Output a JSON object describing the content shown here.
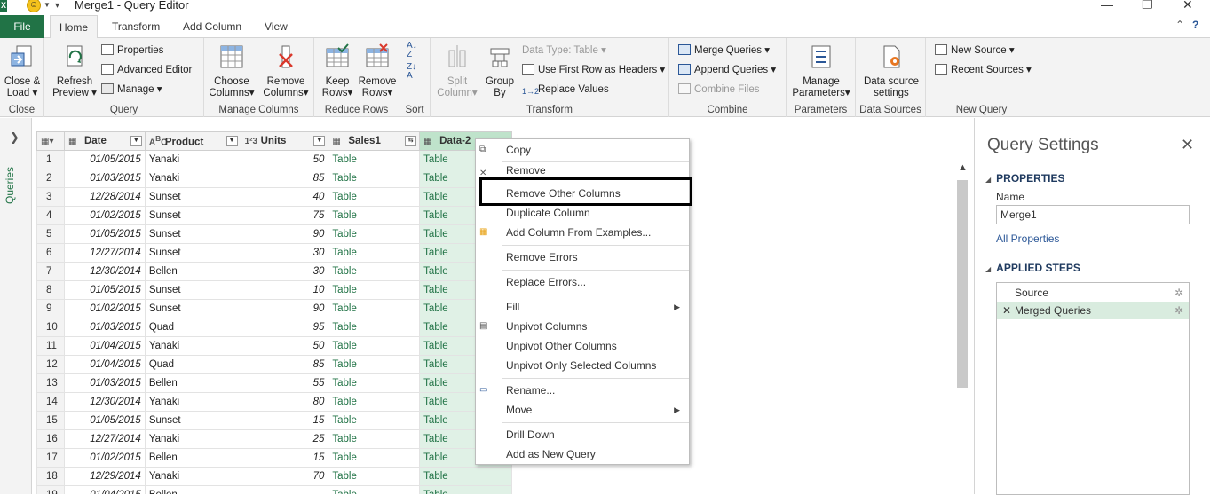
{
  "window": {
    "title": "Merge1 - Query Editor",
    "logo": "X"
  },
  "tabs": [
    "File",
    "Home",
    "Transform",
    "Add Column",
    "View"
  ],
  "ribbon": {
    "close": {
      "btn1": "Close &",
      "btn2": "Load",
      "label": "Close"
    },
    "query": {
      "refresh1": "Refresh",
      "refresh2": "Preview",
      "properties": "Properties",
      "advanced": "Advanced Editor",
      "manage": "Manage",
      "label": "Query"
    },
    "manage_columns": {
      "choose1": "Choose",
      "choose2": "Columns",
      "remove1": "Remove",
      "remove2": "Columns",
      "label": "Manage Columns"
    },
    "reduce_rows": {
      "keep1": "Keep",
      "keep2": "Rows",
      "remove1": "Remove",
      "remove2": "Rows",
      "label": "Reduce Rows"
    },
    "sort": {
      "label": "Sort"
    },
    "transform": {
      "split1": "Split",
      "split2": "Column",
      "group1": "Group",
      "group2": "By",
      "datatype": "Data Type: Table",
      "first_row": "Use First Row as Headers",
      "replace": "Replace Values",
      "label": "Transform"
    },
    "combine": {
      "merge": "Merge Queries",
      "append": "Append Queries",
      "files": "Combine Files",
      "label": "Combine"
    },
    "parameters": {
      "manage1": "Manage",
      "manage2": "Parameters",
      "label": "Parameters"
    },
    "data_sources": {
      "settings1": "Data source",
      "settings2": "settings",
      "label": "Data Sources"
    },
    "new_query": {
      "new_source": "New Source",
      "recent": "Recent Sources",
      "label": "New Query"
    }
  },
  "queries_pane": {
    "label": "Queries"
  },
  "table": {
    "columns": [
      {
        "name": "Date",
        "type_icon": "calendar"
      },
      {
        "name": "Product",
        "type_icon": "ABC"
      },
      {
        "name": "Units",
        "type_icon": "123"
      },
      {
        "name": "Sales1",
        "type_icon": "table"
      },
      {
        "name": "Data-2",
        "type_icon": "table"
      }
    ],
    "rows": [
      [
        "1",
        "01/05/2015",
        "Yanaki",
        "50",
        "Table",
        "Table"
      ],
      [
        "2",
        "01/03/2015",
        "Yanaki",
        "85",
        "Table",
        "Table"
      ],
      [
        "3",
        "12/28/2014",
        "Sunset",
        "40",
        "Table",
        "Table"
      ],
      [
        "4",
        "01/02/2015",
        "Sunset",
        "75",
        "Table",
        "Table"
      ],
      [
        "5",
        "01/05/2015",
        "Sunset",
        "90",
        "Table",
        "Table"
      ],
      [
        "6",
        "12/27/2014",
        "Sunset",
        "30",
        "Table",
        "Table"
      ],
      [
        "7",
        "12/30/2014",
        "Bellen",
        "30",
        "Table",
        "Table"
      ],
      [
        "8",
        "01/05/2015",
        "Sunset",
        "10",
        "Table",
        "Table"
      ],
      [
        "9",
        "01/02/2015",
        "Sunset",
        "90",
        "Table",
        "Table"
      ],
      [
        "10",
        "01/03/2015",
        "Quad",
        "95",
        "Table",
        "Table"
      ],
      [
        "11",
        "01/04/2015",
        "Yanaki",
        "50",
        "Table",
        "Table"
      ],
      [
        "12",
        "01/04/2015",
        "Quad",
        "85",
        "Table",
        "Table"
      ],
      [
        "13",
        "01/03/2015",
        "Bellen",
        "55",
        "Table",
        "Table"
      ],
      [
        "14",
        "12/30/2014",
        "Yanaki",
        "80",
        "Table",
        "Table"
      ],
      [
        "15",
        "01/05/2015",
        "Sunset",
        "15",
        "Table",
        "Table"
      ],
      [
        "16",
        "12/27/2014",
        "Yanaki",
        "25",
        "Table",
        "Table"
      ],
      [
        "17",
        "01/02/2015",
        "Bellen",
        "15",
        "Table",
        "Table"
      ],
      [
        "18",
        "12/29/2014",
        "Yanaki",
        "70",
        "Table",
        "Table"
      ],
      [
        "19",
        "01/04/2015",
        "Bellen",
        "",
        "Table",
        "Table"
      ]
    ]
  },
  "context_menu": {
    "items": [
      "Copy",
      "Remove",
      "Remove Other Columns",
      "Duplicate Column",
      "Add Column From Examples...",
      "Remove Errors",
      "Replace Errors...",
      "Fill",
      "Unpivot Columns",
      "Unpivot Other Columns",
      "Unpivot Only Selected Columns",
      "Rename...",
      "Move",
      "Drill Down",
      "Add as New Query"
    ],
    "highlighted": "Remove Other Columns"
  },
  "query_settings": {
    "title": "Query Settings",
    "properties_header": "PROPERTIES",
    "name_label": "Name",
    "name_value": "Merge1",
    "all_properties": "All Properties",
    "applied_steps_header": "APPLIED STEPS",
    "steps": [
      "Source",
      "Merged Queries"
    ]
  },
  "colors": {
    "excel_green": "#217346",
    "selected_column": "#e0f1e6",
    "link_blue": "#2b5797"
  }
}
